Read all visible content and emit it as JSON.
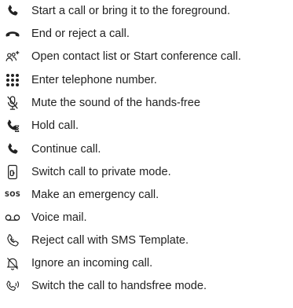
{
  "items": [
    {
      "icon": "phone-handset-icon",
      "label": "Start a call or bring it to the foreground."
    },
    {
      "icon": "hang-up-icon",
      "label": "End or reject a call."
    },
    {
      "icon": "contacts-add-icon",
      "label": "Open contact list or Start conference call."
    },
    {
      "icon": "keypad-icon",
      "label": "Enter telephone number."
    },
    {
      "icon": "mute-microphone-icon",
      "label": "Mute the sound of the hands-free"
    },
    {
      "icon": "hold-call-icon",
      "label": "Hold call."
    },
    {
      "icon": "phone-handset-icon",
      "label": "Continue call."
    },
    {
      "icon": "private-mode-handset-icon",
      "label": "Switch call to private mode."
    },
    {
      "icon": "sos-icon",
      "label": "Make an emergency call.",
      "icon_text": "SOS"
    },
    {
      "icon": "voicemail-icon",
      "label": "Voice mail."
    },
    {
      "icon": "sms-template-reject-icon",
      "label": "Reject call with SMS Template."
    },
    {
      "icon": "bell-muted-icon",
      "label": "Ignore an incoming call."
    },
    {
      "icon": "handsfree-speaker-icon",
      "label": "Switch the call to handsfree mode."
    }
  ]
}
